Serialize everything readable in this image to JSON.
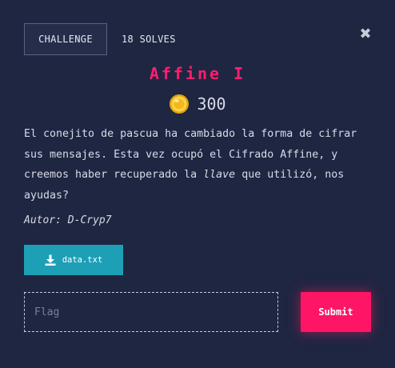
{
  "header": {
    "challenge_tab": "CHALLENGE",
    "solves_label": "18 SOLVES",
    "close_icon": "close-icon"
  },
  "challenge": {
    "title": "Affine I",
    "points": "300",
    "description_before": "El conejito de pascua ha cambiado la forma de cifrar sus mensajes. Esta vez ocupó el Cifrado Affine, y creemos haber recuperado la ",
    "description_emphasis": "llave",
    "description_after": " que utilizó, nos ayudas?",
    "author": "Autor: D-Cryp7"
  },
  "files": {
    "button_label": "data.txt",
    "icon": "download-icon"
  },
  "submission": {
    "placeholder": "Flag",
    "value": "",
    "submit_label": "Submit"
  },
  "colors": {
    "background": "#1f2642",
    "title": "#ff1e6e",
    "file_button": "#1d9fb6",
    "submit_button": "#ff1565"
  }
}
